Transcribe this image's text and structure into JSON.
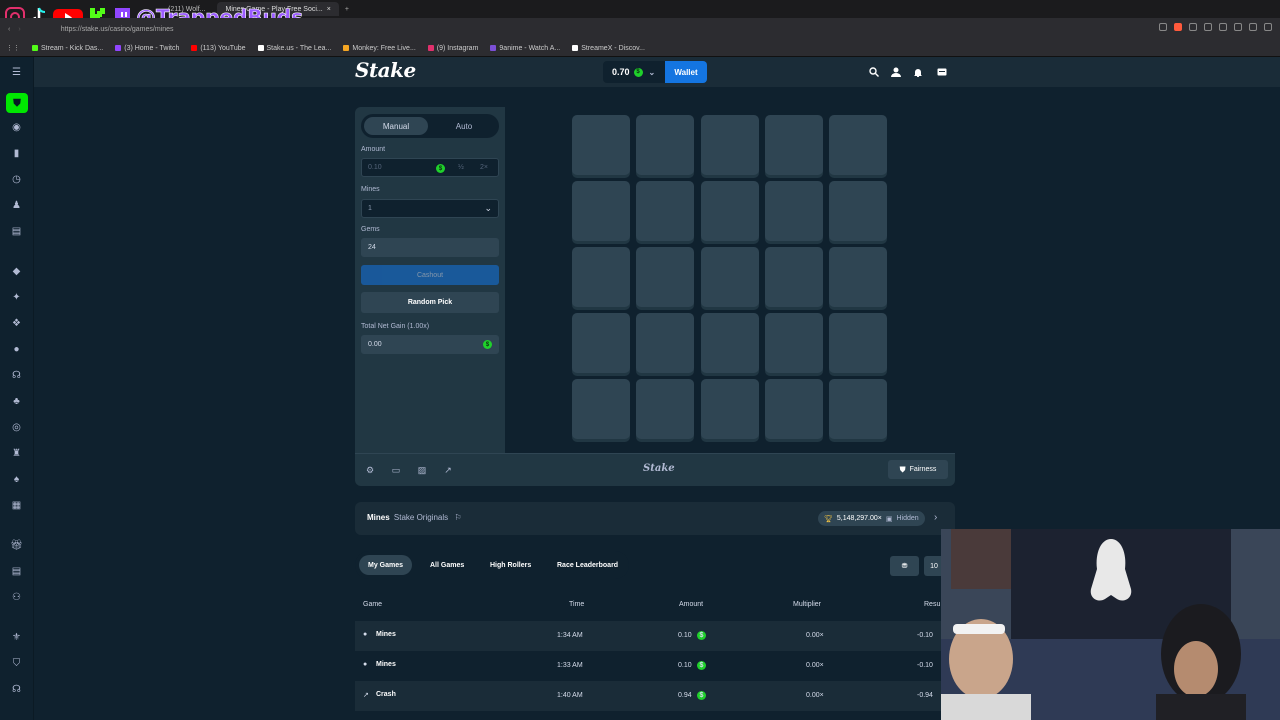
{
  "browser": {
    "tabs": [
      {
        "label": "(211) Wolf..."
      },
      {
        "label": "Mines Game - Play Free Soci..."
      }
    ],
    "url": "https://stake.us/casino/games/mines",
    "overlay_handle": "@TrappedBuds",
    "bookmarks": [
      {
        "label": "Stream - Kick Das...",
        "color": "#53fc18"
      },
      {
        "label": "(3) Home - Twitch",
        "color": "#9146ff"
      },
      {
        "label": "(113) YouTube",
        "color": "#ff0000"
      },
      {
        "label": "Stake.us - The Lea...",
        "color": "#ffffff"
      },
      {
        "label": "Monkey: Free Live...",
        "color": "#f5a623"
      },
      {
        "label": "(9) Instagram",
        "color": "#e1306c"
      },
      {
        "label": "9anime - Watch A...",
        "color": "#7b4fd6"
      },
      {
        "label": "StreameX - Discov...",
        "color": "#ffffff"
      }
    ]
  },
  "header": {
    "logo": "Stake",
    "balance": "0.70",
    "wallet_label": "Wallet"
  },
  "controls": {
    "manual_label": "Manual",
    "auto_label": "Auto",
    "amount_label": "Amount",
    "amount_placeholder": "0.10",
    "half_label": "½",
    "double_label": "2×",
    "mines_label": "Mines",
    "mines_value": "1",
    "gems_label": "Gems",
    "gems_value": "24",
    "cashout_label": "Cashout",
    "random_label": "Random Pick",
    "net_gain_label": "Total Net Gain (1.00x)",
    "net_gain_value": "0.00"
  },
  "footer": {
    "logo": "Stake",
    "fairness_label": "Fairness"
  },
  "info": {
    "game_name": "Mines",
    "provider": "Stake Originals",
    "wagered": "5,148,297.00×",
    "hidden_label": "Hidden"
  },
  "history": {
    "tabs": [
      "My Games",
      "All Games",
      "High Rollers",
      "Race Leaderboard"
    ],
    "page_size": "10",
    "columns": [
      "Game",
      "Time",
      "Amount",
      "Multiplier",
      "Resu..."
    ],
    "rows": [
      {
        "game": "Mines",
        "time": "1:34 AM",
        "amount": "0.10",
        "multiplier": "0.00×",
        "result": "-0.10"
      },
      {
        "game": "Mines",
        "time": "1:33 AM",
        "amount": "0.10",
        "multiplier": "0.00×",
        "result": "-0.10"
      },
      {
        "game": "Crash",
        "time": "1:40 AM",
        "amount": "0.94",
        "multiplier": "0.00×",
        "result": "-0.94"
      }
    ]
  },
  "colors": {
    "bg": "#0f212e",
    "panel": "#213743",
    "tile": "#2f4553",
    "accent_blue": "#1475e1",
    "accent_green": "#00e701"
  }
}
